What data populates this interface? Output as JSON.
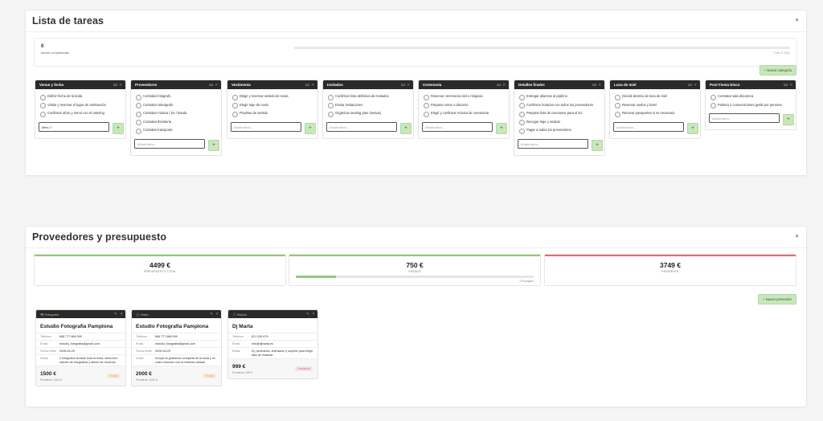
{
  "tasks_section": {
    "title": "Lista de tareas",
    "collapse_icon": "triangle-up-icon",
    "summary": {
      "completed_count": "0",
      "completed_label": "tareas completadas",
      "progress_fraction": 0,
      "count_text": "0 de 27 (0%)"
    },
    "new_category_label": "+ Nueva categoría",
    "add_placeholder": "Añadir tarea...",
    "categories": [
      {
        "name": "Venue y fecha",
        "count": "0/3",
        "tasks": [
          "Definir fecha de la boda",
          "Visitar y reservar el lugar de celebración",
          "Confirmar aforo y menú con el catering"
        ],
        "input_value": "Menu ?"
      },
      {
        "name": "Proveedores",
        "count": "0/5",
        "tasks": [
          "Contratar fotógrafo",
          "Contratar videógrafo",
          "Contratar música / DJ / banda",
          "Contratar floristería",
          "Contratar transporte"
        ],
        "input_value": ""
      },
      {
        "name": "Vestimenta",
        "count": "0/3",
        "tasks": [
          "Elegir y reservar vestido de novia",
          "Elegir traje de novio",
          "Pruebas de vestido"
        ],
        "input_value": ""
      },
      {
        "name": "Invitados",
        "count": "0/3",
        "tasks": [
          "Confirmar lista definitiva de invitados",
          "Enviar invitaciones",
          "Organizar seating plan (mesas)"
        ],
        "input_value": ""
      },
      {
        "name": "Ceremonia",
        "count": "0/3",
        "tasks": [
          "Reservar ceremonia civil o religiosa",
          "Preparar votos o discurso",
          "Elegir y confirmar música de ceremonia"
        ],
        "input_value": ""
      },
      {
        "name": "Detalles finales",
        "count": "0/5",
        "tasks": [
          "Entregar alianzas al padrino",
          "Confirmar horarios con todos los proveedores",
          "Preparar lista de canciones para el DJ",
          "Recoger traje y vestido",
          "Pagar a todos los proveedores"
        ],
        "input_value": ""
      },
      {
        "name": "Luna de miel",
        "count": "0/3",
        "tasks": [
          "Decidir destino de luna de miel",
          "Reservar vuelos y hotel",
          "Renovar pasaportes si es necesario"
        ],
        "input_value": ""
      },
      {
        "name": "Post Fiesta Disco",
        "count": "0/2",
        "tasks": [
          "Contratar sala discoteca",
          "Pulsera 2 consumiciones gratis por persona"
        ],
        "input_value": ""
      }
    ]
  },
  "providers_section": {
    "title": "Proveedores y presupuesto",
    "collapse_icon": "triangle-up-icon",
    "stats": [
      {
        "value": "4499 €",
        "label": "PRESUPUESTO TOTAL",
        "color": "#8fc97a"
      },
      {
        "value": "750 €",
        "label": "PAGADO",
        "color": "#8fc97a",
        "progress_fraction": 0.17,
        "pct_text": "17% pagado"
      },
      {
        "value": "3749 €",
        "label": "PENDIENTE",
        "color": "#e36a6a"
      }
    ],
    "new_provider_label": "+ Nuevo proveedor",
    "labels": {
      "phone": "Teléfono",
      "email": "Email",
      "date": "Fecha límite",
      "notes": "Notas"
    },
    "providers": [
      {
        "type": "📷 Fotografía",
        "name": "Estudio Fotografía Pamplona",
        "phone": "666 777 888 999",
        "email": "estudio_fotografia@gmail.com",
        "date": "2026-06-25",
        "notes": "2 fotógrafos durante toda la boda, selección, edición de fotografías y álbum de recuerdo",
        "amount": "1500 €",
        "pending": "Pendiente: 1500 €",
        "status": "Parcial",
        "status_color": "#e8a13a"
      },
      {
        "type": "🎥 Vídeo",
        "name": "Estudio Fotografía Pamplona",
        "phone": "666 777 888 999",
        "email": "estudio_fotografia@gmail.com",
        "date": "2026-06-25",
        "notes": "Incluye la grabación completa de la boda y un vídeo resumen con la máxima calidad",
        "amount": "2000 €",
        "pending": "Pendiente: 2000 €",
        "status": "Parcial",
        "status_color": "#e8a13a"
      },
      {
        "type": "🎵 Música",
        "name": "Dj Marta",
        "phone": "621 245 678",
        "email": "info@djmarta.es",
        "notes": "Dj, pinchando, animación y soporte para elegir lista de músicas.",
        "amount": "999 €",
        "pending": "Pendiente: 999 €",
        "status": "Pendiente",
        "status_color": "#e36a6a"
      }
    ]
  }
}
